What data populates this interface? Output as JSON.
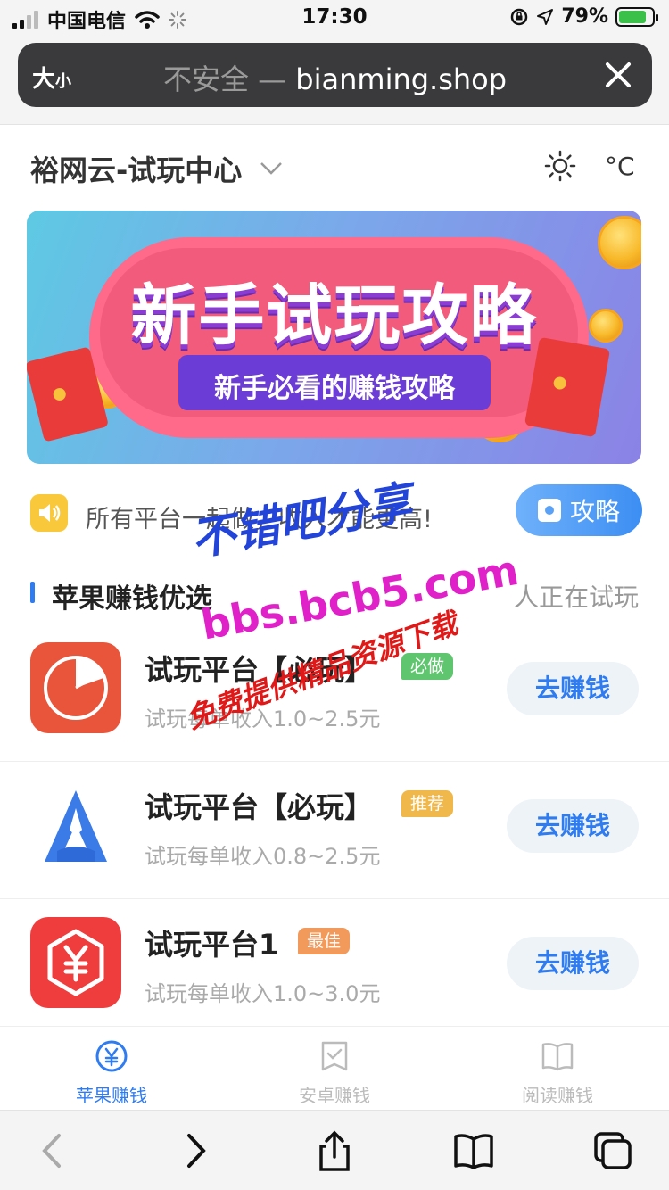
{
  "status_bar": {
    "carrier": "中国电信",
    "time": "17:30",
    "battery_percent": "79%"
  },
  "url_bar": {
    "text_size_label": "大",
    "text_size_small": "小",
    "security_label": "不安全 —",
    "domain": "bianming.shop"
  },
  "header": {
    "site_title": "裕网云-试玩中心",
    "temperature_unit": "°C"
  },
  "banner": {
    "title": "新手试玩攻略",
    "subtitle": "新手必看的赚钱攻略"
  },
  "notice": {
    "text": "所有平台一起做，收入才能更高!",
    "guide_button": "攻略"
  },
  "section": {
    "title": "苹果赚钱优选",
    "right_text": "人正在试玩"
  },
  "apps": [
    {
      "name": "试玩平台【必玩】",
      "badge": "必做",
      "badge_color": "#5fc66f",
      "desc": "试玩每单收入1.0~2.5元",
      "button": "去赚钱"
    },
    {
      "name": "试玩平台【必玩】",
      "badge": "推荐",
      "badge_color": "#f0b84a",
      "desc": "试玩每单收入0.8~2.5元",
      "button": "去赚钱"
    },
    {
      "name": "试玩平台1",
      "badge": "最佳",
      "badge_color": "#f29a5b",
      "desc": "试玩每单收入1.0~3.0元",
      "button": "去赚钱"
    }
  ],
  "tabs": [
    {
      "label": "苹果赚钱",
      "icon": "yen-circle-icon",
      "active": true
    },
    {
      "label": "安卓赚钱",
      "icon": "checkbox-icon",
      "active": false
    },
    {
      "label": "阅读赚钱",
      "icon": "book-icon",
      "active": false
    }
  ],
  "watermark": {
    "line1": "不错吧分享",
    "line2": "bbs.bcb5.com",
    "line3": "免费提供精品资源下载"
  },
  "colors": {
    "accent": "#2f7cf0",
    "watermark_blue": "#2244d8",
    "watermark_magenta": "#e020c8",
    "watermark_red": "#e01818"
  }
}
